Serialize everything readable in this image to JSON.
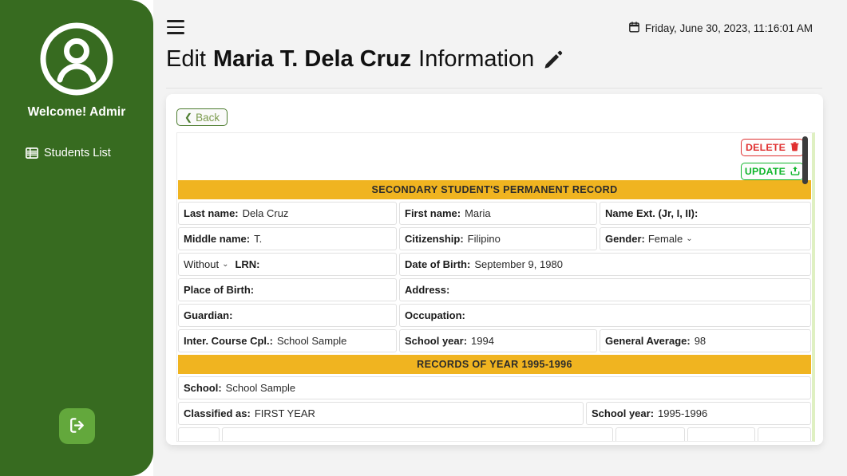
{
  "sidebar": {
    "avatar_icon": "user-circle-icon",
    "welcome": "Welcome! Admir",
    "items": [
      {
        "label": "Students List",
        "icon": "table-list-icon"
      }
    ],
    "logout_icon": "logout-icon",
    "bg_color": "#376B20",
    "logout_bg": "#63A83C"
  },
  "topbar": {
    "menu_icon": "hamburger-menu-icon",
    "calendar_icon": "calendar-icon",
    "datetime": "Friday, June 30, 2023, 11:16:01 AM"
  },
  "title": {
    "prefix": "Edit",
    "name": "Maria T. Dela Cruz",
    "suffix": "Information",
    "edit_icon": "pencil-icon"
  },
  "card": {
    "back_label": "Back",
    "back_icon": "chevron-left-icon",
    "delete_label": "DELETE",
    "delete_icon": "trash-icon",
    "delete_color": "#E03131",
    "update_label": "UPDATE",
    "update_icon": "upload-icon",
    "update_color": "#0FB52A"
  },
  "permanent_record": {
    "banner": "Secondary student's permanent record",
    "banner_color": "#F0B420",
    "rows": [
      [
        {
          "label": "Last name:",
          "value": "Dela Cruz",
          "width": "c-33"
        },
        {
          "label": "First name:",
          "value": "Maria",
          "width": "c-34"
        },
        {
          "label": "Name Ext. (Jr, I, II):",
          "value": "",
          "width": "c-wide"
        }
      ],
      [
        {
          "label": "Middle name:",
          "value": "T.",
          "width": "c-33"
        },
        {
          "label": "Citizenship:",
          "value": "Filipino",
          "width": "c-34"
        },
        {
          "label": "Gender:",
          "value": "Female",
          "width": "c-wide",
          "select": true
        }
      ],
      [
        {
          "label": "LRN:",
          "value": "",
          "width": "c-33",
          "prefix_select": "Without"
        },
        {
          "label": "Date of Birth:",
          "value": "September 9, 1980",
          "width": "c-half-r"
        }
      ],
      [
        {
          "label": "Place of Birth:",
          "value": "",
          "width": "c-33"
        },
        {
          "label": "Address:",
          "value": "",
          "width": "c-half-r"
        }
      ],
      [
        {
          "label": "Guardian:",
          "value": "",
          "width": "c-33"
        },
        {
          "label": "Occupation:",
          "value": "",
          "width": "c-half-r"
        }
      ],
      [
        {
          "label": "Inter. Course Cpl.:",
          "value": "School Sample",
          "width": "c-33"
        },
        {
          "label": "School year:",
          "value": "1994",
          "width": "c-34"
        },
        {
          "label": "General Average:",
          "value": "98",
          "width": "c-wide"
        }
      ]
    ]
  },
  "year_record": {
    "banner": "Records of year 1995-1996",
    "rows": [
      [
        {
          "label": "School:",
          "value": "School Sample",
          "width": "c-full"
        }
      ],
      [
        {
          "label": "Classified as:",
          "value": "FIRST YEAR",
          "width": "c-half-l"
        },
        {
          "label": "School year:",
          "value": "1995-1996",
          "width": "c-half-r"
        }
      ]
    ]
  },
  "scroll": {
    "thumb_color": "#3C3C3C"
  }
}
